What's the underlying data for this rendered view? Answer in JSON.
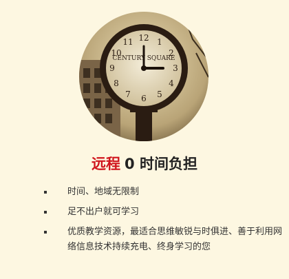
{
  "photo": {
    "clock_face_text": "CENTURY SQUARE",
    "dial_numbers": [
      "12",
      "1",
      "2",
      "3",
      "4",
      "5",
      "6",
      "7",
      "8",
      "9",
      "10",
      "11"
    ]
  },
  "heading": {
    "accent": "远程",
    "text": "0 时间负担"
  },
  "features": [
    {
      "text": "时间、地域无限制"
    },
    {
      "text": "足不出户就可学习"
    },
    {
      "text": "优质教学资源，最适合思维敏锐与时俱进、善于利用网络信息技术持续充电、终身学习的您"
    }
  ],
  "colors": {
    "background": "#fdf7e1",
    "accent": "#d0141c",
    "text": "#333333"
  }
}
